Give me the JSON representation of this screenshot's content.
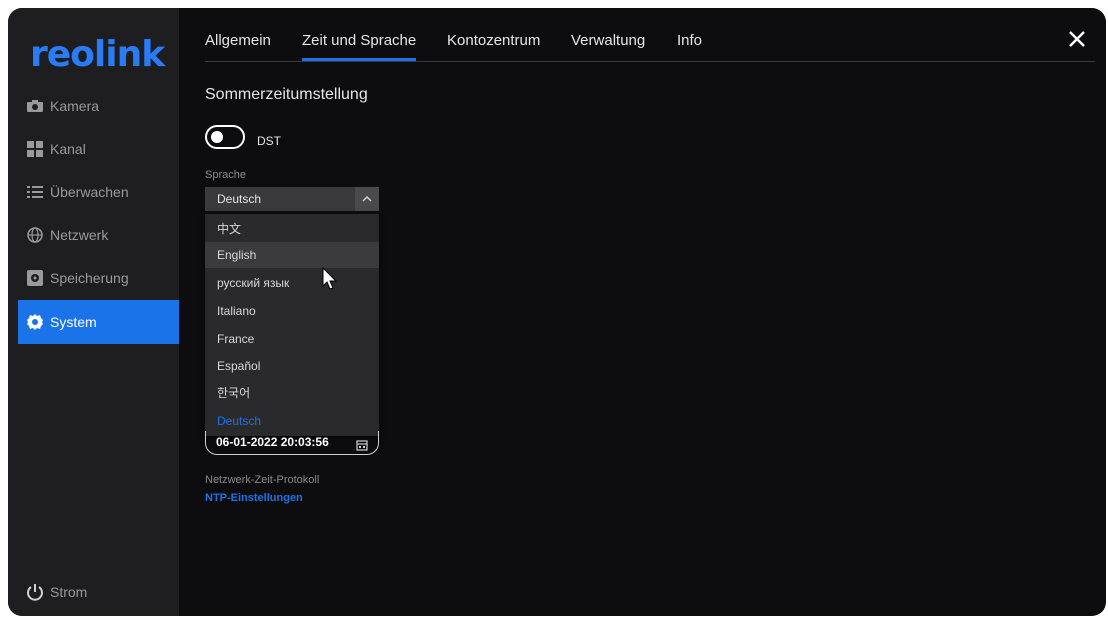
{
  "app": {
    "logo_text": "reolink"
  },
  "sidebar": {
    "items": [
      {
        "label": "Kamera",
        "icon": "camera-icon"
      },
      {
        "label": "Kanal",
        "icon": "grid-icon"
      },
      {
        "label": "Überwachen",
        "icon": "list-icon"
      },
      {
        "label": "Netzwerk",
        "icon": "globe-icon"
      },
      {
        "label": "Speicherung",
        "icon": "storage-icon"
      },
      {
        "label": "System",
        "icon": "gear-icon"
      }
    ],
    "power_label": "Strom"
  },
  "tabs": [
    {
      "label": "Allgemein"
    },
    {
      "label": "Zeit und Sprache"
    },
    {
      "label": "Kontozentrum"
    },
    {
      "label": "Verwaltung"
    },
    {
      "label": "Info"
    }
  ],
  "active_tab": "Zeit und Sprache",
  "dst_section": {
    "title": "Sommerzeitumstellung",
    "toggle_label": "DST",
    "enabled": false
  },
  "language": {
    "label": "Sprache",
    "selected": "Deutsch",
    "options": [
      "中文",
      "English",
      "русский язык",
      "Italiano",
      "France",
      "Español",
      "한국어",
      "Deutsch"
    ],
    "hovered": "English"
  },
  "datetime": {
    "value": "06-01-2022 20:03:56"
  },
  "ntp": {
    "label": "Netzwerk-Zeit-Protokoll",
    "link": "NTP-Einstellungen"
  },
  "colors": {
    "accent": "#1a73e8",
    "background": "#0d0d0f",
    "sidebar": "#1e1e20"
  }
}
